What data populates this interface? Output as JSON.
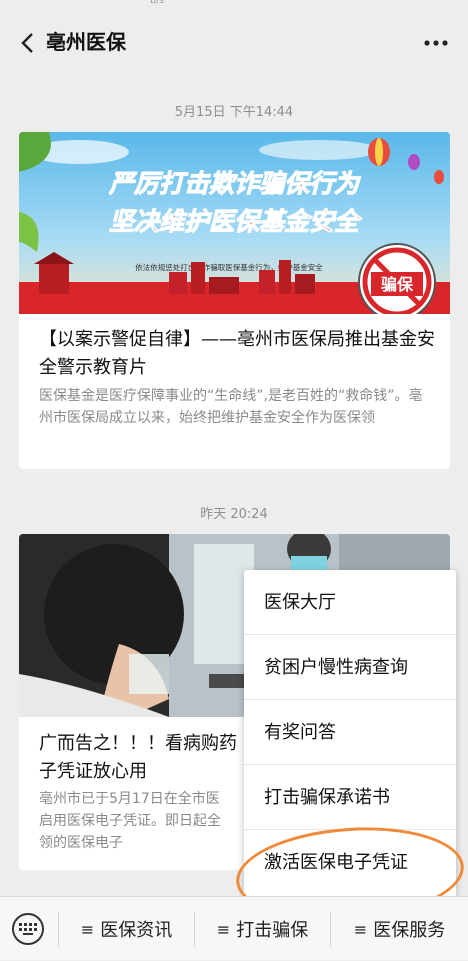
{
  "header": {
    "title": "亳州医保"
  },
  "articles": [
    {
      "timestamp": "5月15日 下午14:44",
      "banner": {
        "line1": "严厉打击欺诈骗保行为",
        "line2": "坚决维护医保基金安全",
        "caption": "依法依规惩处打击欺诈骗取医保基金行为，维护基金安全",
        "stamp": "骗保"
      },
      "title": "【以案示警促自律】——亳州市医保局推出基金安全警示教育片",
      "description": "医保基金是医疗保障事业的“生命线”,是老百姓的“救命钱”。亳州市医保局成立以来，始终把维护基金安全作为医保领"
    },
    {
      "timestamp": "昨天 20:24",
      "title": "广而告之！！！看病购药",
      "title_line2": "子凭证放心用",
      "description_line1": "亳州市已于5月17日在全市医",
      "description_line2": "启用医保电子凭证。即日起全",
      "description_line3": "领的医保电子"
    }
  ],
  "popup_menu": {
    "items": [
      "医保大厅",
      "贫困户慢性病查询",
      "有奖问答",
      "打击骗保承诺书",
      "激活医保电子凭证"
    ]
  },
  "bottom_menu": {
    "tabs": [
      "医保资讯",
      "打击骗保",
      "医保服务"
    ]
  },
  "colors": {
    "banner_red": "#d8262b",
    "banner_sky": "#7fc9ee",
    "highlight_circle": "#f08a3a"
  }
}
